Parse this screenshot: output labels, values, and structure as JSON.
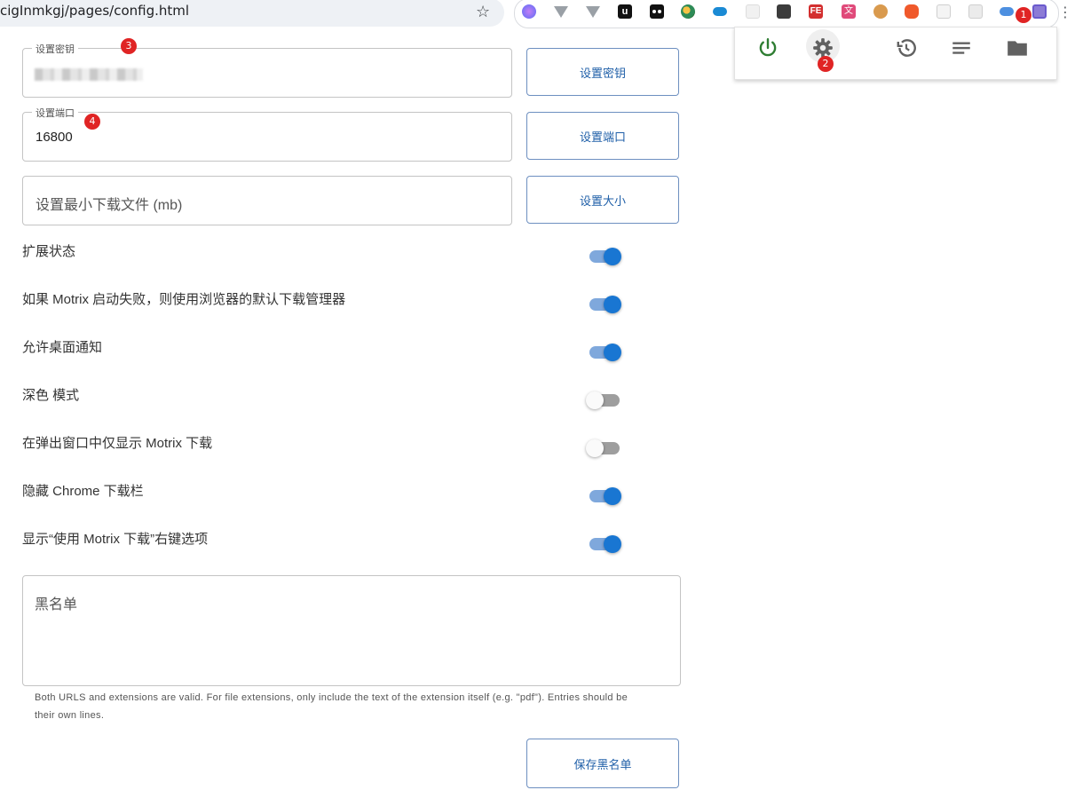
{
  "browser": {
    "url": "cigInmkgj/pages/config.html",
    "extensions": [
      "brain-ext-icon",
      "vue-ext-icon",
      "vue-ext-icon-2",
      "u-ext-icon",
      "tampermonkey-icon",
      "globe-ext-icon",
      "cloud-ext-icon",
      "grid-ext-icon",
      "network-ext-icon",
      "fe-ext-icon",
      "translate-ext-icon",
      "cookie-ext-icon",
      "orange-ext-icon",
      "cat-ext-icon",
      "cat-ext-icon-2",
      "cloud-sync-ext-icon",
      "motrix-ext-icon"
    ],
    "fe_label": "FE"
  },
  "badges": {
    "b1": "1",
    "b2": "2",
    "b3": "3",
    "b4": "4"
  },
  "popup": {
    "items": [
      "power-icon",
      "settings-icon",
      "history-icon",
      "list-icon",
      "folder-icon"
    ]
  },
  "form": {
    "key": {
      "legend": "设置密钥",
      "button": "设置密钥"
    },
    "port": {
      "legend": "设置端口",
      "value": "16800",
      "button": "设置端口"
    },
    "size": {
      "placeholder": "设置最小下载文件 (mb)",
      "button": "设置大小"
    }
  },
  "settings": [
    {
      "label": "扩展状态",
      "on": true
    },
    {
      "label": "如果 Motrix 启动失败，则使用浏览器的默认下载管理器",
      "on": true
    },
    {
      "label": "允许桌面通知",
      "on": true
    },
    {
      "label": "深色 模式",
      "on": false
    },
    {
      "label": "在弹出窗口中仅显示 Motrix 下载",
      "on": false
    },
    {
      "label": "隐藏 Chrome 下载栏",
      "on": true
    },
    {
      "label": "显示“使用 Motrix 下载”右键选项",
      "on": true
    }
  ],
  "blacklist": {
    "placeholder": "黑名单",
    "helper": "Both URLS and extensions are valid. For file extensions, only include the text of the extension itself (e.g. \"pdf\"). Entries should be their own lines.",
    "save_button": "保存黑名单"
  },
  "colors": {
    "accent": "#1976d2",
    "power": "#2e7d32",
    "badge": "#e02424"
  }
}
